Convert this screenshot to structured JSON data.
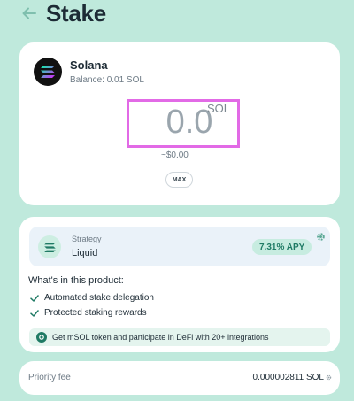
{
  "header": {
    "title": "Stake"
  },
  "token": {
    "name": "Solana",
    "balance": "Balance: 0.01 SOL"
  },
  "amount": {
    "value": "0.0",
    "unit": "SOL",
    "usd": "~$0.00",
    "max_label": "MAX"
  },
  "strategy": {
    "label": "Strategy",
    "value": "Liquid",
    "apy": "7.31% APY"
  },
  "features": {
    "title": "What's in this product:",
    "items": [
      "Automated stake delegation",
      "Protected staking rewards"
    ]
  },
  "promo": {
    "text": "Get mSOL token and participate in DeFi with 20+ integrations"
  },
  "fee": {
    "label": "Priority fee",
    "value": "0.000002811 SOL"
  },
  "colors": {
    "background": "#bfe9dc",
    "accent": "#1f7a64",
    "highlight": "#e26ae6"
  },
  "icons": [
    "arrow-left-icon",
    "solana-logo",
    "gear-icon",
    "check-icon",
    "coin-icon"
  ]
}
